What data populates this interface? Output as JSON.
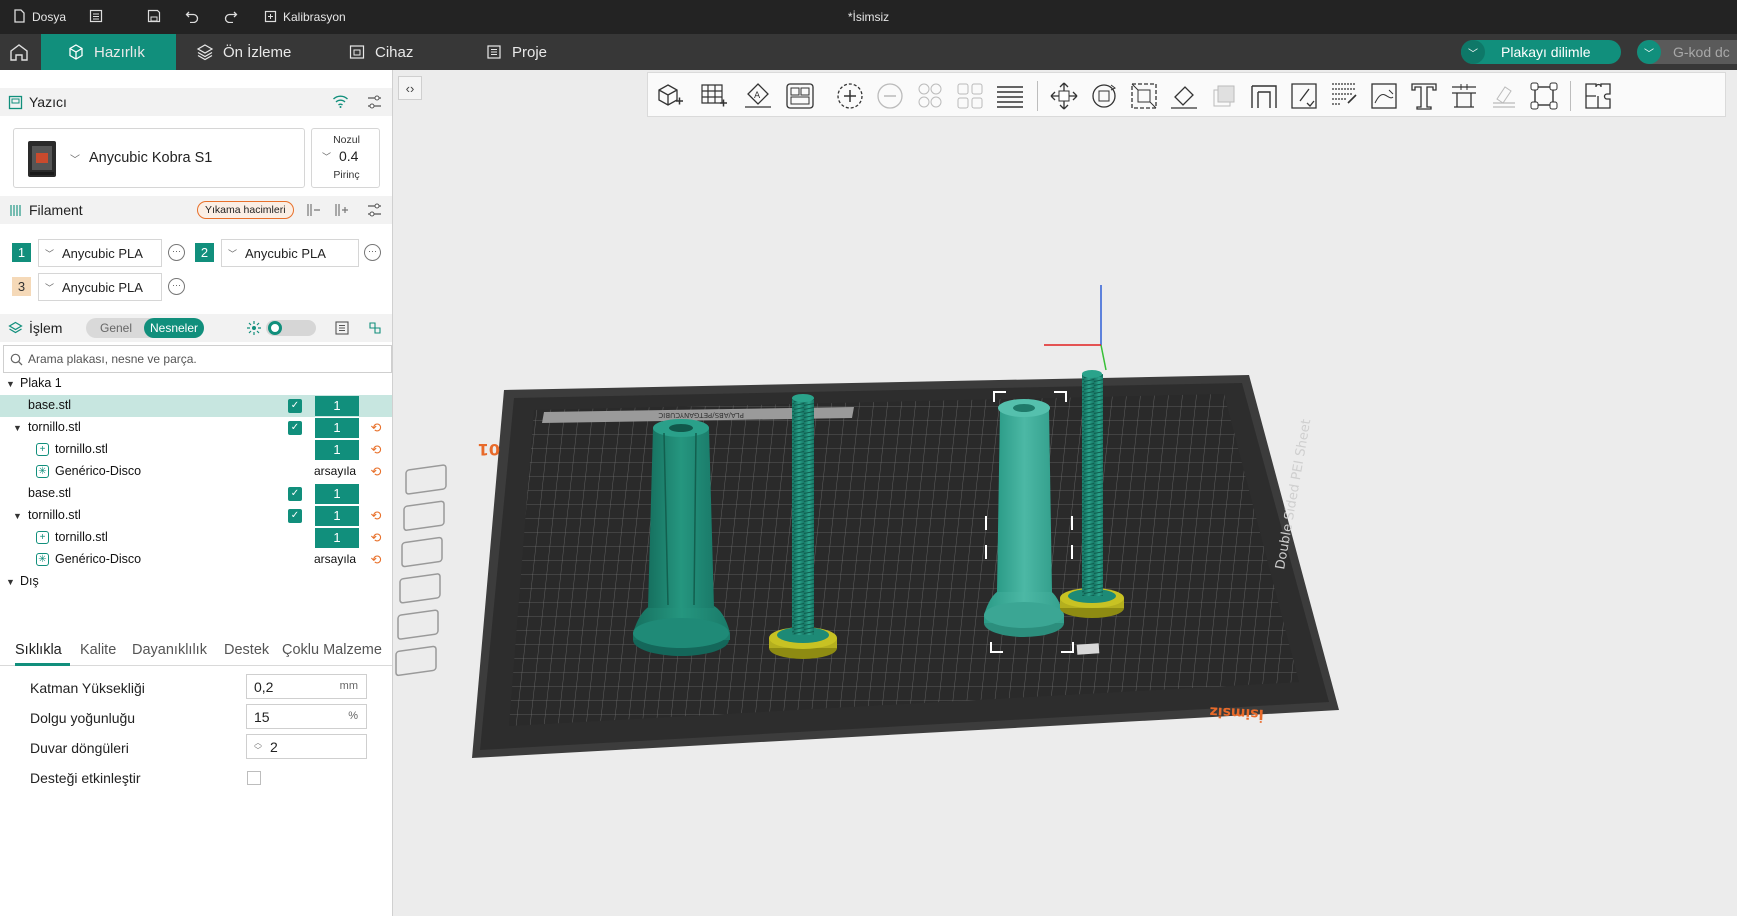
{
  "titlebar": {
    "file_label": "Dosya",
    "calibration_label": "Kalibrasyon",
    "doc_title": "*İsimsiz"
  },
  "tabs": {
    "prepare": "Hazırlık",
    "preview": "Ön İzleme",
    "device": "Cihaz",
    "project": "Proje",
    "slice_label": "Plakayı dilimle",
    "gcode_label": "G-kod dc"
  },
  "printer": {
    "section": "Yazıcı",
    "name": "Anycubic Kobra S1",
    "nozzle_label": "Nozul",
    "nozzle_value": "0.4",
    "nozzle_material": "Pirinç"
  },
  "filament": {
    "section": "Filament",
    "flush_label": "Yıkama hacimleri",
    "slots": [
      {
        "num": "1",
        "name": "Anycubic PLA",
        "color": "#118f7c"
      },
      {
        "num": "2",
        "name": "Anycubic PLA",
        "color": "#118f7c"
      },
      {
        "num": "3",
        "name": "Anycubic PLA",
        "color": "#f5d9b8"
      }
    ]
  },
  "process": {
    "section": "İşlem",
    "mode_general": "Genel",
    "mode_objects": "Nesneler",
    "search_placeholder": "Arama plakası, nesne ve parça."
  },
  "tree": {
    "plate": "Plaka 1",
    "rows": [
      {
        "label": "base.stl",
        "count": "1"
      },
      {
        "label": "tornillo.stl",
        "count": "1"
      },
      {
        "label": "tornillo.stl",
        "count": "1"
      },
      {
        "label": "Genérico-Disco",
        "value": "arsayıla"
      },
      {
        "label": "base.stl",
        "count": "1"
      },
      {
        "label": "tornillo.stl",
        "count": "1"
      },
      {
        "label": "tornillo.stl",
        "count": "1"
      },
      {
        "label": "Genérico-Disco",
        "value": "arsayıla"
      }
    ],
    "outside": "Dış"
  },
  "settings": {
    "tabs": [
      "Sıklıkla",
      "Kalite",
      "Dayanıklılık",
      "Destek",
      "Çoklu Malzeme"
    ],
    "layer_height_label": "Katman Yüksekliği",
    "layer_height_value": "0,2",
    "layer_height_unit": "mm",
    "infill_label": "Dolgu yoğunluğu",
    "infill_value": "15",
    "infill_unit": "%",
    "walls_label": "Duvar döngüleri",
    "walls_value": "2",
    "support_label": "Desteği etkinleştir"
  },
  "plate": {
    "brand_label": "ANYCUBIC",
    "materials_label": "PLA/ABS/PETG",
    "sheet_label": "Double Sided PEI Sheet",
    "plate_name": "İsimsiz",
    "plate_number": "01"
  },
  "colors": {
    "accent": "#118f7c",
    "object": "#1f8c7a",
    "selected_object": "#3aa898",
    "washer": "#b8b41f",
    "bed": "#303030"
  }
}
